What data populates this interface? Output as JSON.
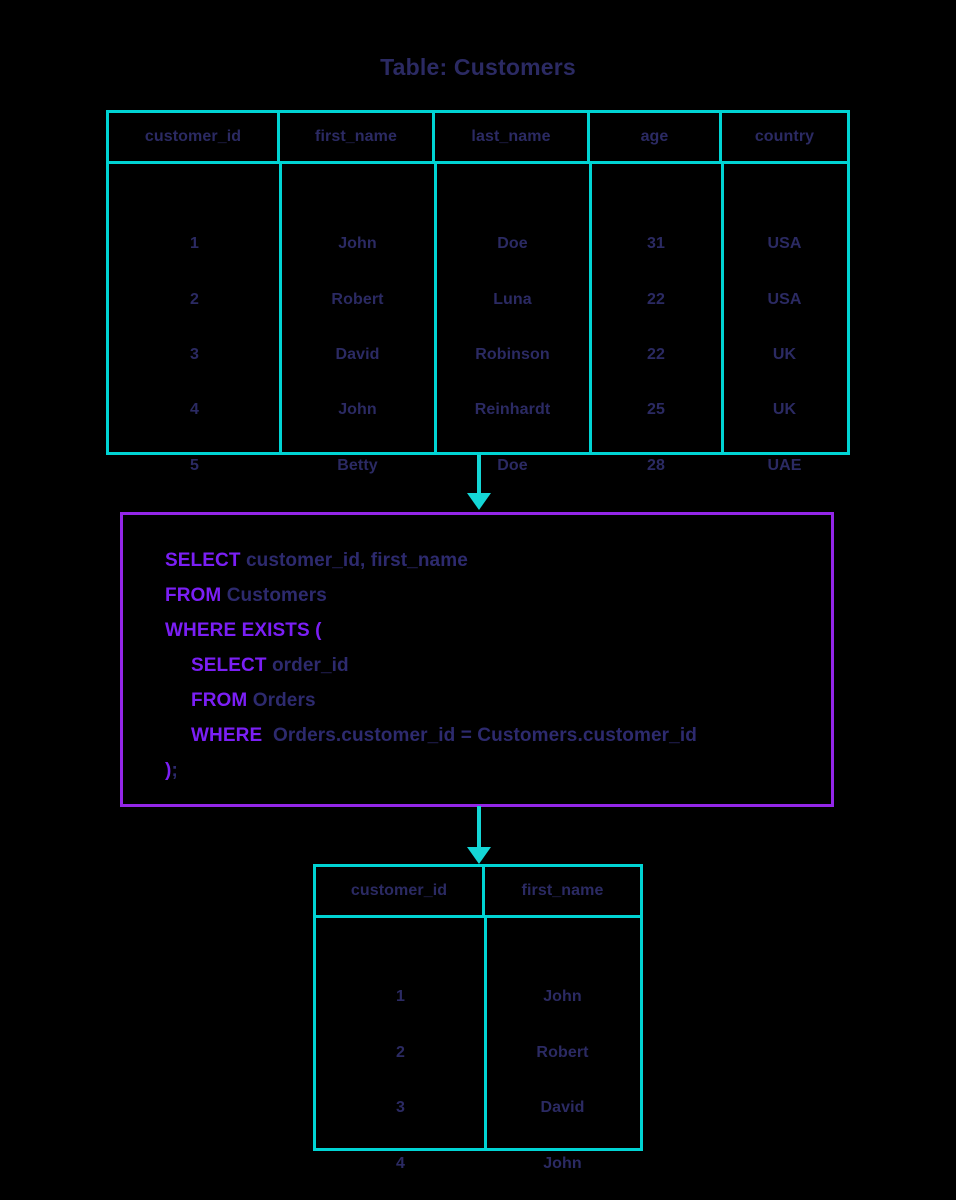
{
  "page": {
    "background_color": "#000000",
    "accent_teal": "#00d4d4",
    "accent_purple": "#9326e8",
    "keyword_purple": "#7b1ff5",
    "text_navy": "#2b2a63"
  },
  "title": "Table: Customers",
  "source_table": {
    "name": "Customers",
    "columns": [
      "customer_id",
      "first_name",
      "last_name",
      "age",
      "country"
    ],
    "rows": [
      [
        "1",
        "John",
        "Doe",
        "31",
        "USA"
      ],
      [
        "2",
        "Robert",
        "Luna",
        "22",
        "USA"
      ],
      [
        "3",
        "David",
        "Robinson",
        "22",
        "UK"
      ],
      [
        "4",
        "John",
        "Reinhardt",
        "25",
        "UK"
      ],
      [
        "5",
        "Betty",
        "Doe",
        "28",
        "UAE"
      ]
    ]
  },
  "query": {
    "lines": [
      {
        "indent": 0,
        "tokens": [
          {
            "t": "kw",
            "v": "SELECT"
          },
          {
            "t": "ident",
            "v": " customer_id, first_name"
          }
        ]
      },
      {
        "indent": 0,
        "tokens": [
          {
            "t": "kw",
            "v": "FROM"
          },
          {
            "t": "ident",
            "v": " Customers"
          }
        ]
      },
      {
        "indent": 0,
        "tokens": [
          {
            "t": "kw",
            "v": "WHERE EXISTS ("
          }
        ]
      },
      {
        "indent": 1,
        "tokens": [
          {
            "t": "kw",
            "v": "SELECT"
          },
          {
            "t": "ident",
            "v": " order_id"
          }
        ]
      },
      {
        "indent": 1,
        "tokens": [
          {
            "t": "kw",
            "v": "FROM"
          },
          {
            "t": "ident",
            "v": " Orders"
          }
        ]
      },
      {
        "indent": 1,
        "tokens": [
          {
            "t": "kw",
            "v": "WHERE"
          },
          {
            "t": "ident",
            "v": "  Orders.customer_id = Customers.customer_id"
          }
        ]
      },
      {
        "indent": 0,
        "tokens": [
          {
            "t": "kw",
            "v": ")"
          },
          {
            "t": "ident",
            "v": ";"
          }
        ]
      }
    ],
    "plain_text": "SELECT customer_id, first_name\nFROM Customers\nWHERE EXISTS (\n    SELECT order_id\n    FROM Orders\n    WHERE  Orders.customer_id = Customers.customer_id\n);"
  },
  "result_table": {
    "columns": [
      "customer_id",
      "first_name"
    ],
    "rows": [
      [
        "1",
        "John"
      ],
      [
        "2",
        "Robert"
      ],
      [
        "3",
        "David"
      ],
      [
        "4",
        "John"
      ]
    ]
  },
  "arrows": [
    {
      "name": "arrow-table-to-query",
      "direction": "down"
    },
    {
      "name": "arrow-query-to-result",
      "direction": "down"
    }
  ]
}
